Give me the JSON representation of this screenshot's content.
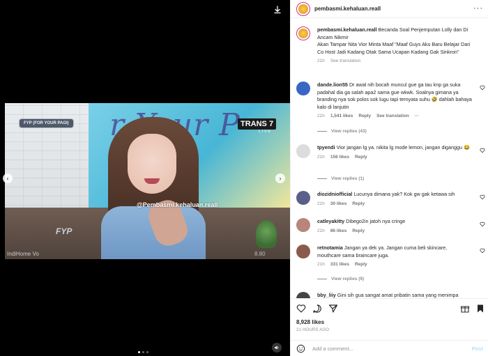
{
  "media": {
    "watermark": "@Pembasmi.kehaluan.reall",
    "badge": "FYP (FOR YOUR PAGI)",
    "tv_logo": "TRANS 7",
    "tv_live": "LIVE",
    "corner_left": "IndiHome Vo",
    "corner_right": "8.80",
    "fyp_overlay": "FYP",
    "screen_text": "r Your P",
    "slide_count": 3,
    "active_slide": 1
  },
  "post": {
    "username": "pembasmi.kehaluan.reall",
    "caption_user": "pembasmi.kehaluan.reall",
    "caption_text": "Becanda Soal Penjemputan Lolly dan Di Ancam Nikmir",
    "caption_text2": "Akan Tampar Nita Vior Minta Maaf \"Maaf Guys Aku Baru Belajar Dari Co Host Jadi Kadang Otak Sama Ucapan Kadang Gak Sinkron\"",
    "caption_time": "21h",
    "see_translation": "See translation"
  },
  "comments": [
    {
      "user": "dande.lion55",
      "text": "Dr awal nih bocah muncul gue ga tau knp ga suka padahal dia ga salah apa2 sama gue wkwk. Soalnya gimana ya branding nya sok polos sok lugu tapi ternyata suhu 🤣 dahlah bahaya kalo di lanjutin",
      "time": "21h",
      "likes": "1,541 likes",
      "reply": "Reply",
      "extra": "See translation",
      "more": "···",
      "view_replies": "View replies (43)",
      "avatar_color": "#3a66c4"
    },
    {
      "user": "tpyendi",
      "text": "Vior jangan lg ya. nikita lg mode lemon, jangan diganggu 😂",
      "time": "21h",
      "likes": "156 likes",
      "reply": "Reply",
      "view_replies": "View replies (1)",
      "avatar_color": "#dcdcdc"
    },
    {
      "user": "diozidniofficial",
      "text": "Lucunya dimana yak? Kok gw gak ketawa sih",
      "time": "21h",
      "likes": "30 likes",
      "reply": "Reply",
      "avatar_color": "#5a5f8a"
    },
    {
      "user": "catleyakitty",
      "text": "Dibego2in jatoh nya cringe",
      "time": "21h",
      "likes": "86 likes",
      "reply": "Reply",
      "avatar_color": "#b7857a"
    },
    {
      "user": "retnotamia",
      "text": "Jangan ya dek ya. Jangan cuma beli skincare, mouthcare sama braincare juga.",
      "time": "21h",
      "likes": "331 likes",
      "reply": "Reply",
      "view_replies": "View replies (9)",
      "avatar_color": "#8a5a4e"
    },
    {
      "user": "bby_liiy",
      "text": "Gini sih gua sangat amat pribatin sama yang menimpa",
      "avatar_color": "#444444"
    }
  ],
  "footer": {
    "likes": "8,928 likes",
    "time_ago": "21 HOURS AGO",
    "comment_placeholder": "Add a comment...",
    "post_label": "Post"
  },
  "colors": {
    "accent": "#0095f6",
    "muted": "#8e8e8e",
    "avatar_ring": "#c9308b"
  },
  "icons": {
    "download": "download-icon",
    "mute": "volume-icon",
    "like": "heart-icon",
    "comment": "comment-icon",
    "share": "send-icon",
    "gift": "gift-icon",
    "save": "bookmark-icon",
    "emoji": "smiley-icon"
  }
}
